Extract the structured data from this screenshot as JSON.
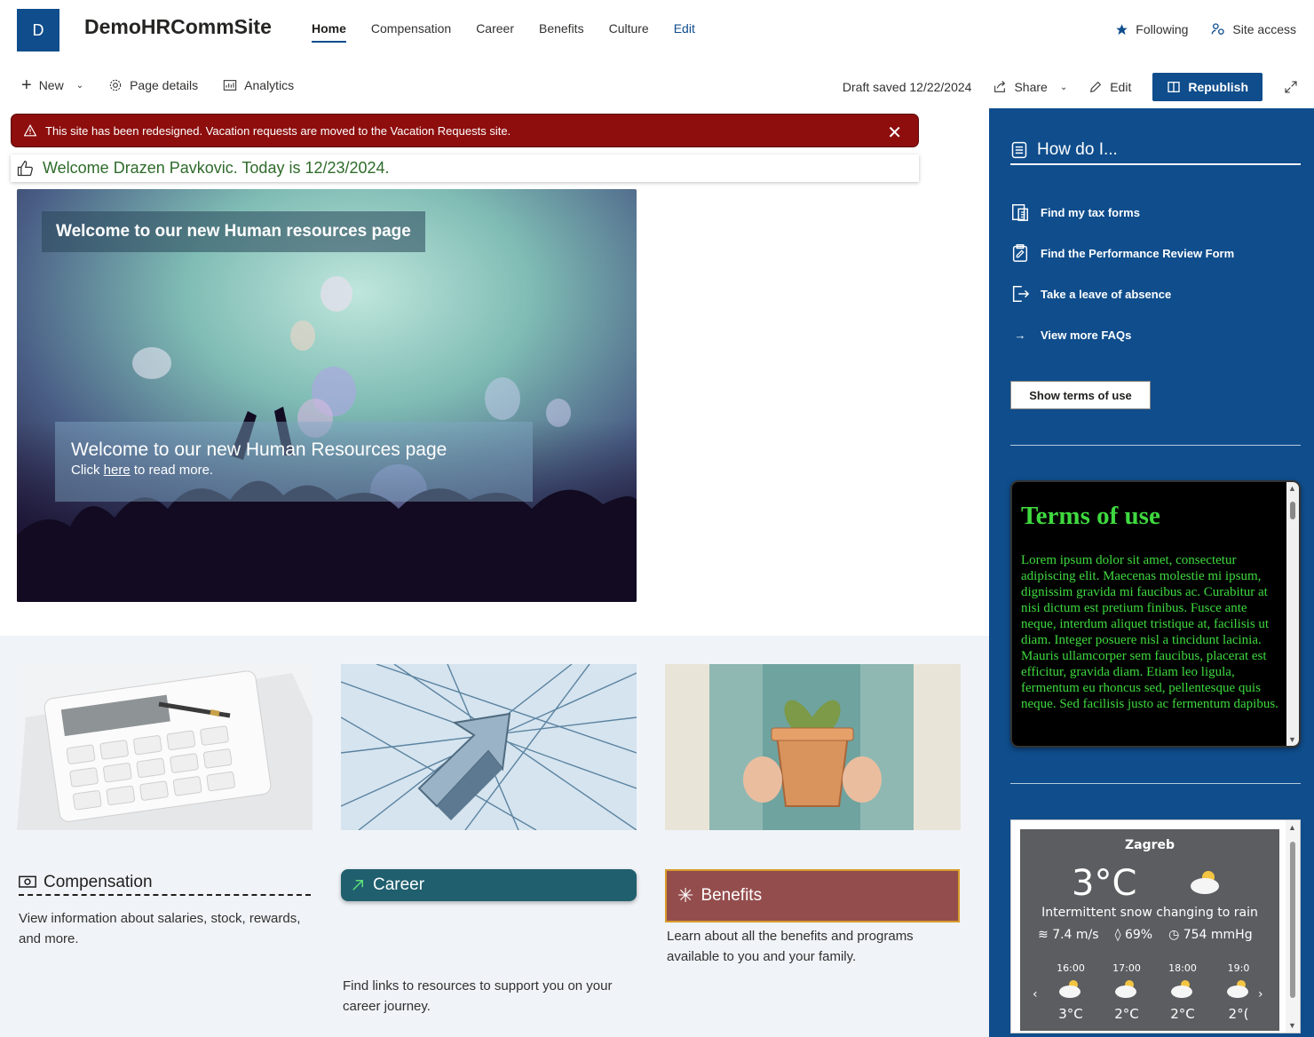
{
  "header": {
    "logo_letter": "D",
    "site_title": "DemoHRCommSite",
    "nav": [
      {
        "label": "Home",
        "active": true
      },
      {
        "label": "Compensation"
      },
      {
        "label": "Career"
      },
      {
        "label": "Benefits"
      },
      {
        "label": "Culture"
      },
      {
        "label": "Edit"
      }
    ],
    "following_label": "Following",
    "site_access_label": "Site access"
  },
  "commandbar": {
    "new_label": "New",
    "page_details_label": "Page details",
    "analytics_label": "Analytics",
    "draft_status": "Draft saved 12/22/2024",
    "share_label": "Share",
    "edit_label": "Edit",
    "republish_label": "Republish"
  },
  "alert": {
    "text": "This site has been redesigned. Vacation requests are moved to the Vacation Requests site."
  },
  "welcome": {
    "text": "Welcome Drazen Pavkovic. Today is 12/23/2024."
  },
  "hero": {
    "title": "Welcome to our new Human resources page",
    "card_heading": "Welcome to our new Human Resources page",
    "card_text_before": "Click ",
    "card_link": "here",
    "card_text_after": " to read more."
  },
  "tiles": {
    "compensation": {
      "title": "Compensation",
      "desc": "View information about salaries, stock, rewards, and more."
    },
    "career": {
      "title": "Career",
      "desc": "Find links to resources to support you on your career journey."
    },
    "benefits": {
      "title": "Benefits",
      "desc": "Learn about all the benefits and programs available to you and your family."
    }
  },
  "sidebar": {
    "howdo_title": "How do I...",
    "links": [
      {
        "label": "Find my tax forms",
        "icon": "tax-form-icon"
      },
      {
        "label": "Find the Performance Review Form",
        "icon": "clipboard-icon"
      },
      {
        "label": "Take a leave of absence",
        "icon": "sign-out-icon"
      },
      {
        "label": "View more FAQs",
        "icon": "arrow-right-icon"
      }
    ],
    "terms_button": "Show terms of use",
    "terms_title": "Terms of use",
    "terms_text": "Lorem ipsum dolor sit amet, consectetur adipiscing elit. Maecenas molestie mi ipsum, dignissim gravida mi faucibus ac. Curabitur at nisi dictum est pretium finibus. Fusce ante neque, interdum aliquet tristique at, facilisis ut diam. Integer posuere nisl a tincidunt lacinia. Mauris ullamcorper sem faucibus, placerat est efficitur, gravida diam. Etiam leo ligula, fermentum eu rhoncus sed, pellentesque quis neque. Sed facilisis justo ac fermentum dapibus."
  },
  "weather": {
    "city": "Zagreb",
    "temp": "3°C",
    "condition": "Intermittent snow changing to rain",
    "wind": "7.4 m/s",
    "humidity": "69%",
    "pressure": "754 mmHg",
    "hourly": [
      {
        "time": "16:00",
        "temp": "3°C"
      },
      {
        "time": "17:00",
        "temp": "2°C"
      },
      {
        "time": "18:00",
        "temp": "2°C"
      },
      {
        "time": "19:0",
        "temp": "2°("
      }
    ]
  },
  "colors": {
    "brand": "#0f4d8c",
    "alert_bg": "#8e0e0e",
    "career_bg": "#1f5f6e",
    "benefits_bg": "#944d4d",
    "terms_text": "#3fd93f"
  }
}
